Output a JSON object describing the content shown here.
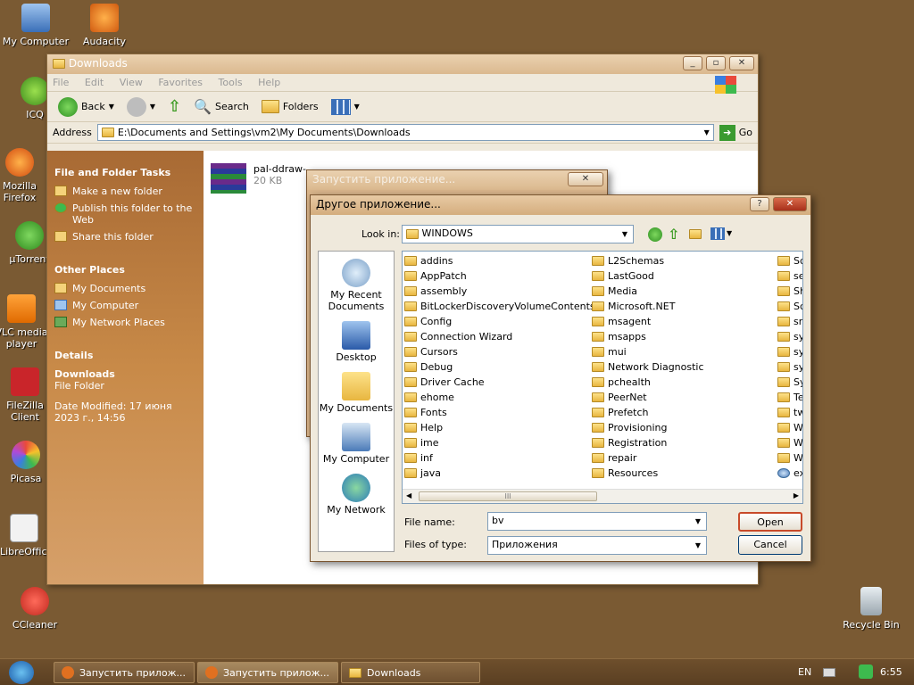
{
  "desktop": {
    "icons": [
      "My Computer",
      "Audacity",
      "ICQ",
      "Mozilla Firefox",
      "µTorrent",
      "VLC media player",
      "FileZilla Client",
      "Picasa",
      "LibreOffice",
      "CCleaner",
      "Recycle Bin"
    ]
  },
  "explorer": {
    "title": "Downloads",
    "menu": [
      "File",
      "Edit",
      "View",
      "Favorites",
      "Tools",
      "Help"
    ],
    "back": "Back",
    "search": "Search",
    "folders": "Folders",
    "address_label": "Address",
    "address": "E:\\Documents and Settings\\vm2\\My Documents\\Downloads",
    "go": "Go",
    "tasks_title": "File and Folder Tasks",
    "tasks": [
      "Make a new folder",
      "Publish this folder to the Web",
      "Share this folder"
    ],
    "other_title": "Other Places",
    "other": [
      "My Documents",
      "My Computer",
      "My Network Places"
    ],
    "details_title": "Details",
    "details_name": "Downloads",
    "details_type": "File Folder",
    "details_date": "Date Modified: 17 июня 2023 г., 14:56",
    "file_name": "pal-ddraw-",
    "file_size": "20 KB"
  },
  "bg_dialog": {
    "title": "Запустить приложение..."
  },
  "dialog": {
    "title": "Другое приложение...",
    "lookin_label": "Look in:",
    "lookin_value": "WINDOWS",
    "places": [
      "My Recent Documents",
      "Desktop",
      "My Documents",
      "My Computer",
      "My Network"
    ],
    "col1": [
      "addins",
      "AppPatch",
      "assembly",
      "BitLockerDiscoveryVolumeContents",
      "Config",
      "Connection Wizard",
      "Cursors",
      "Debug",
      "Driver Cache",
      "ehome",
      "Fonts",
      "Help",
      "ime",
      "inf",
      "java"
    ],
    "col2": [
      "L2Schemas",
      "LastGood",
      "Media",
      "Microsoft.NET",
      "msagent",
      "msapps",
      "mui",
      "Network Diagnostic",
      "pchealth",
      "PeerNet",
      "Prefetch",
      "Provisioning",
      "Registration",
      "repair",
      "Resources"
    ],
    "col3": [
      "Sc",
      "se",
      "Sh",
      "Sc",
      "sr",
      "sy",
      "sy",
      "sy",
      "Sy",
      "Te",
      "tw",
      "W",
      "W",
      "W",
      "ex"
    ],
    "filename_label": "File name:",
    "filename_value": "bv",
    "filetype_label": "Files of type:",
    "filetype_value": "Приложения",
    "open": "Open",
    "cancel": "Cancel",
    "scroll_grip": "III"
  },
  "taskbar": {
    "items": [
      "Запустить прилож...",
      "Запустить прилож...",
      "Downloads"
    ],
    "lang": "EN",
    "time": "6:55"
  }
}
